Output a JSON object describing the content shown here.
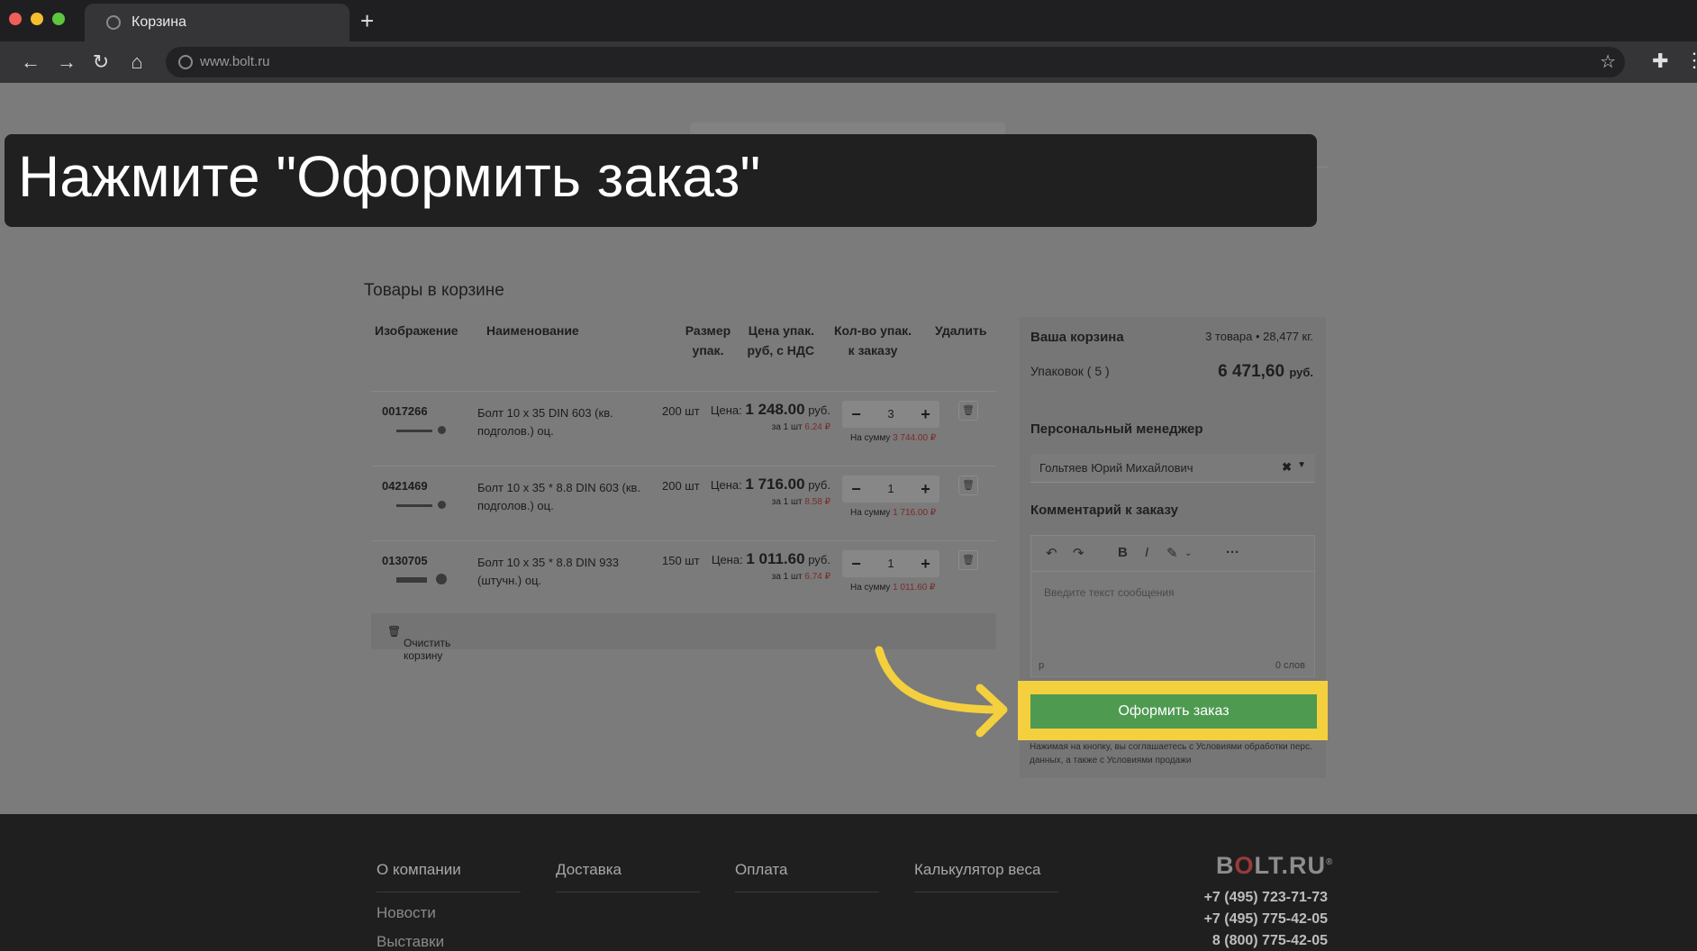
{
  "browser": {
    "tab_title": "Корзина",
    "url": "www.bolt.ru"
  },
  "instruction": "Нажмите \"Оформить заказ\"",
  "cart": {
    "section_title": "Товары в корзине",
    "headers": {
      "image": "Изображение",
      "name": "Наименование",
      "size": "Размер упак.",
      "price": "Цена упак. руб, с НДС",
      "qty": "Кол-во упак. к заказу",
      "delete": "Удалить"
    },
    "items": [
      {
        "sku": "0017266",
        "name": "Болт 10 x 35 DIN 603 (кв. подголов.) оц.",
        "size": "200 шт",
        "price_label": "Цена:",
        "price": "1 248.00",
        "currency": "руб.",
        "unit_label": "за 1 шт",
        "unit_price": "6.24 ₽",
        "qty": "3",
        "sum_label": "На сумму",
        "sum": "3 744.00 ₽"
      },
      {
        "sku": "0421469",
        "name": "Болт 10 x 35 * 8.8 DIN 603 (кв. подголов.) оц.",
        "size": "200 шт",
        "price_label": "Цена:",
        "price": "1 716.00",
        "currency": "руб.",
        "unit_label": "за 1 шт",
        "unit_price": "8.58 ₽",
        "qty": "1",
        "sum_label": "На сумму",
        "sum": "1 716.00 ₽"
      },
      {
        "sku": "0130705",
        "name": "Болт 10 x 35 * 8.8 DIN 933 (штучн.) оц.",
        "size": "150 шт",
        "price_label": "Цена:",
        "price": "1 011.60",
        "currency": "руб.",
        "unit_label": "за 1 шт",
        "unit_price": "6.74 ₽",
        "qty": "1",
        "sum_label": "На сумму",
        "sum": "1 011.60 ₽"
      }
    ],
    "clear_label": "Очистить корзину"
  },
  "summary": {
    "title": "Ваша корзина",
    "meta": "3 товара • 28,477 кг.",
    "packs": "Упаковок ( 5 )",
    "total": "6 471,60",
    "currency": "руб.",
    "manager_title": "Персональный менеджер",
    "manager_name": "Гольтяев Юрий Михайлович",
    "comment_title": "Комментарий к заказу",
    "comment_placeholder": "Введите текст сообщения",
    "editor_path": "p",
    "word_count": "0 слов",
    "order_button": "Оформить заказ",
    "legal": "Нажимая на кнопку, вы соглашаетесь с Условиями обработки перс. данных, а также с Условиями продажи"
  },
  "footer": {
    "nav": [
      "О компании",
      "Доставка",
      "Оплата",
      "Калькулятор веса"
    ],
    "sub": [
      "Новости",
      "Выставки"
    ],
    "logo_left": "B",
    "logo_o": "O",
    "logo_right": "LT.RU",
    "logo_mark": "®",
    "phones": [
      "+7 (495) 723-71-73",
      "+7 (495) 775-42-05",
      "8 (800) 775-42-05"
    ]
  },
  "colors": {
    "highlight": "#f4d03e",
    "order_button": "#4e9a51",
    "overlay": "#202020"
  }
}
